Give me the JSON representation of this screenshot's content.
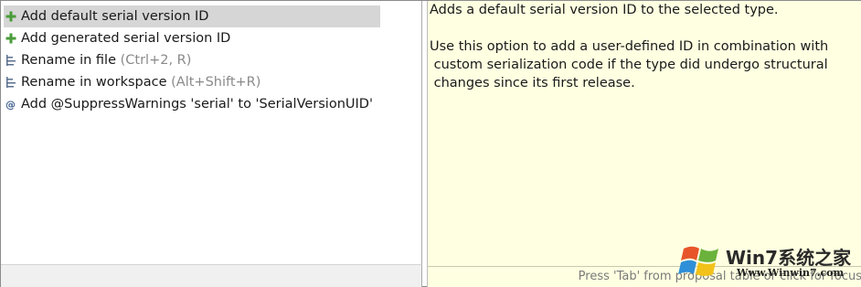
{
  "proposals": [
    {
      "label": "Add default serial version ID",
      "hint": "",
      "icon": "add-plus-icon",
      "selected": true
    },
    {
      "label": "Add generated serial version ID",
      "hint": "",
      "icon": "add-plus-icon",
      "selected": false
    },
    {
      "label": "Rename in file",
      "hint": "(Ctrl+2, R)",
      "icon": "rename-icon",
      "selected": false
    },
    {
      "label": "Rename in workspace",
      "hint": "(Alt+Shift+R)",
      "icon": "rename-icon",
      "selected": false
    },
    {
      "label": "Add @SuppressWarnings 'serial' to 'SerialVersionUID'",
      "hint": "",
      "icon": "annotation-icon",
      "selected": false
    }
  ],
  "description": {
    "line1": "Adds a default serial version ID to the selected type.",
    "line2": "Use this option to add a user-defined ID in combination with",
    "line3": " custom serialization code if the type did undergo structural",
    "line4": " changes since its first release."
  },
  "status": {
    "text": "Press 'Tab' from proposal table or click for focus"
  },
  "watermark": {
    "brand": "Win7系统之家",
    "url": "Www.Winwin7.com"
  },
  "colors": {
    "add_icon": "#4a9c3a",
    "rename_icon": "#5a6f8f",
    "annotation_icon": "#3a5a8a",
    "desc_bg": "#ffffe1",
    "selection": "#d6d6d6"
  }
}
